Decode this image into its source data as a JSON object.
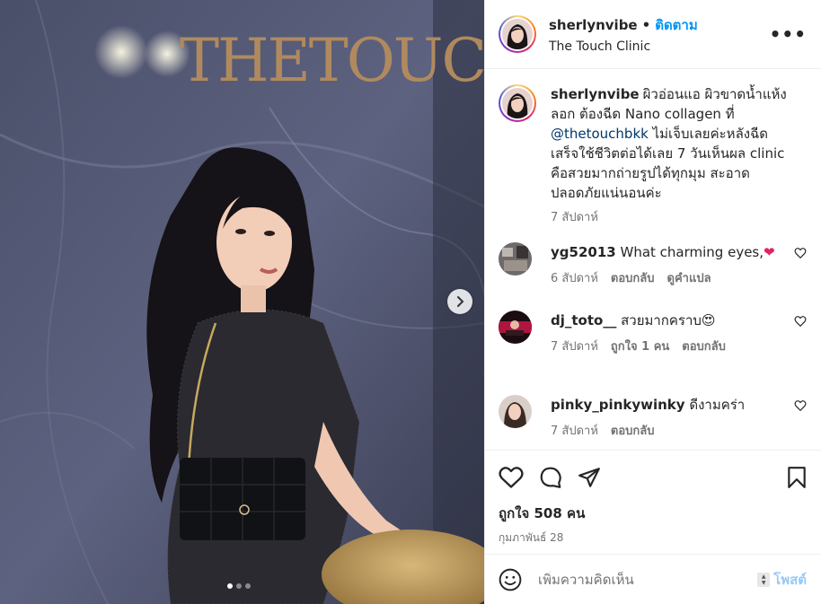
{
  "post": {
    "sign_text": "THETOUCH",
    "carousel": {
      "total_slides": 3,
      "active_slide": 1
    }
  },
  "header": {
    "username": "sherlynvibe",
    "separator": "•",
    "follow_label": "ติดตาม",
    "location": "The Touch Clinic",
    "more_label": "•••"
  },
  "caption": {
    "username": "sherlynvibe",
    "text_before": "ผิวอ่อนแอ ผิวขาดน้ำแห้งลอก ต้องฉีด Nano collagen ที่ ",
    "mention": "@thetouchbkk",
    "text_after": " ไม่เจ็บเลยค่ะหลังฉีดเสร็จใช้ชีวิตต่อได้เลย 7 วันเห็นผล clinic คือสวยมากถ่ายรูปได้ทุกมุม สะอาดปลอดภัยแน่นอนค่ะ",
    "time": "7 สัปดาห์"
  },
  "comments": [
    {
      "username": "yg52013",
      "text": "What charming eyes,",
      "emoji": "❤",
      "time": "6 สัปดาห์",
      "reply": "ตอบกลับ",
      "translate": "ดูคำแปล"
    },
    {
      "username": "dj_toto__",
      "text": "สวยมากคราบ",
      "emoji": "😍",
      "time": "7 สัปดาห์",
      "likes": "ถูกใจ 1 คน",
      "reply": "ตอบกลับ"
    },
    {
      "username": "pinky_pinkywinky",
      "text": "ดีงามคร่า",
      "time": "7 สัปดาห์",
      "reply": "ตอบกลับ"
    }
  ],
  "actions": {
    "likes": "ถูกใจ 508 คน",
    "date": "กุมภาพันธ์ 28"
  },
  "add_comment": {
    "placeholder": "เพิ่มความคิดเห็น",
    "post_label": "โพสต์"
  },
  "icons": [
    "heart-icon",
    "comment-icon",
    "share-icon",
    "bookmark-icon",
    "emoji-icon",
    "more-icon",
    "chevron-right-icon"
  ],
  "colors": {
    "link": "#0095f6",
    "mention": "#00376b",
    "muted": "#737373",
    "like_red": "#e0245e"
  }
}
